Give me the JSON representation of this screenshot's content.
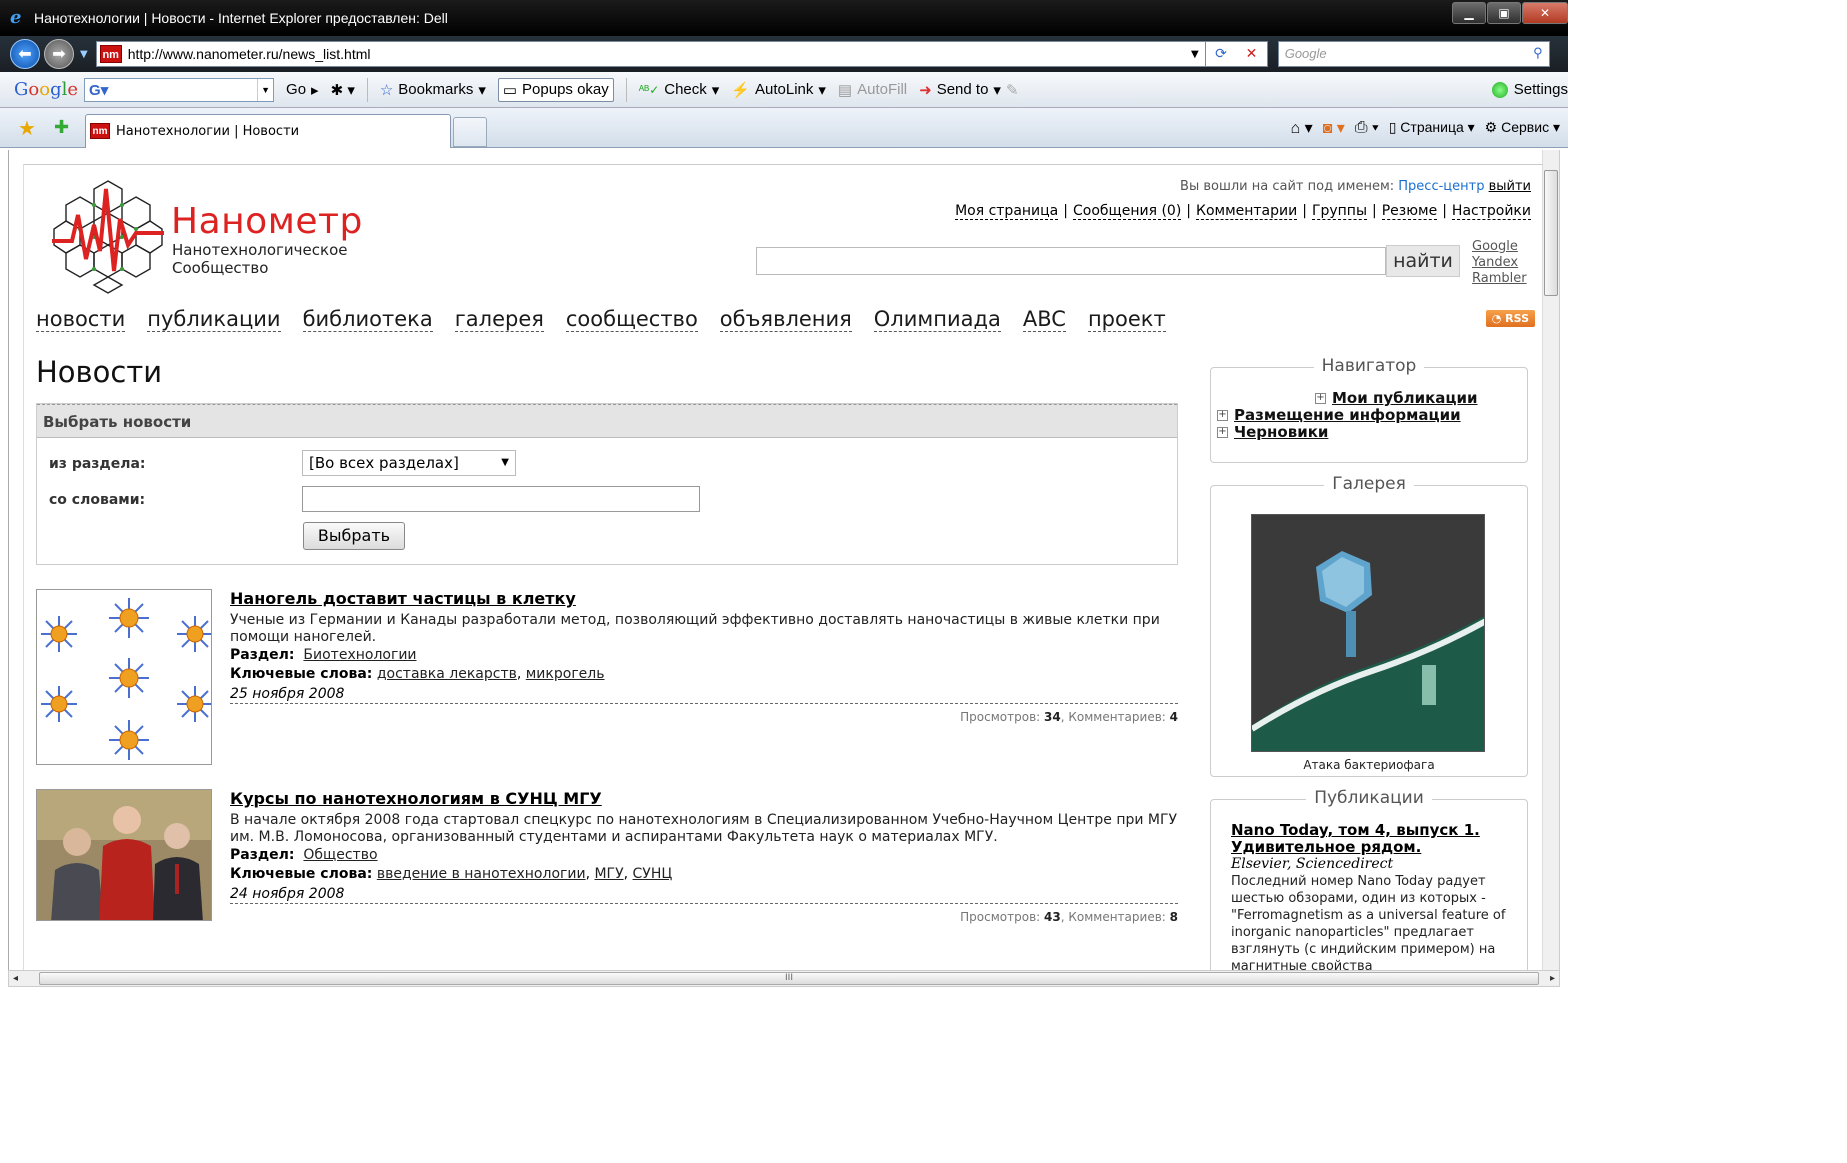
{
  "window": {
    "title": "Нанотехнологии | Новости - Internet Explorer предоставлен: Dell",
    "url": "http://www.nanometer.ru/news_list.html",
    "search_placeholder": "Google"
  },
  "google_toolbar": {
    "logo": "Google",
    "go_label": "Go",
    "bookmarks_label": "Bookmarks",
    "popups_label": "Popups okay",
    "check_label": "Check",
    "autolink_label": "AutoLink",
    "autofill_label": "AutoFill",
    "sendto_label": "Send to",
    "settings_label": "Settings"
  },
  "tabs": {
    "active_label": "Нанотехнологии | Новости"
  },
  "command_bar": {
    "page_label": "Страница",
    "tools_label": "Сервис"
  },
  "site": {
    "brand": "Нанометр",
    "tagline_line1": "Нанотехнологическое",
    "tagline_line2": "Сообщество",
    "logged_in_prefix": "Вы вошли на сайт под именем:",
    "username": "Пресс-центр",
    "logout": "выйти",
    "user_menu": [
      "Моя страница",
      "Сообщения (0)",
      "Комментарии",
      "Группы",
      "Резюме",
      "Настройки"
    ],
    "search_button": "найти",
    "search_engines": [
      "Google",
      "Yandex",
      "Rambler"
    ],
    "nav": [
      "новости",
      "публикации",
      "библиотека",
      "галерея",
      "сообщество",
      "объявления",
      "Олимпиада",
      "ABC",
      "проект"
    ],
    "rss": "RSS"
  },
  "main": {
    "page_title": "Новости",
    "filter": {
      "heading": "Выбрать новости",
      "section_label": "из раздела:",
      "section_value": "[Во всех разделах]",
      "words_label": "со словами:",
      "words_value": "",
      "submit": "Выбрать"
    },
    "news": [
      {
        "title": "Наногель доставит частицы в клетку",
        "lead": "Ученые из Германии и Канады разработали метод, позволяющий эффективно доставлять наночастицы в живые клетки при помощи наногелей.",
        "section_label": "Раздел:",
        "section": "Биотехнологии",
        "keywords_label": "Ключевые слова:",
        "keywords": [
          "доставка лекарств",
          "микрогель"
        ],
        "date": "25 ноября 2008",
        "views_label": "Просмотров:",
        "views": "34",
        "comments_label": "Комментариев:",
        "comments": "4"
      },
      {
        "title": "Курсы по нанотехнологиям в СУНЦ МГУ",
        "lead": "В начале октября 2008 года стартовал спецкурс по нанотехнологиям в Специализированном Учебно-Научном Центре при МГУ им. М.В. Ломоносова, организованный студентами и аспирантами Факультета наук о материалах МГУ.",
        "section_label": "Раздел:",
        "section": "Общество",
        "keywords_label": "Ключевые слова:",
        "keywords": [
          "введение в нанотехнологии",
          "МГУ",
          "СУНЦ"
        ],
        "date": "24 ноября 2008",
        "views_label": "Просмотров:",
        "views": "43",
        "comments_label": "Комментариев:",
        "comments": "8"
      }
    ]
  },
  "sidebar": {
    "navigator": {
      "title": "Навигатор",
      "items": [
        "Мои публикации",
        "Размещение информации",
        "Черновики"
      ]
    },
    "gallery": {
      "title": "Галерея",
      "caption": "Атака бактериофага"
    },
    "publications": {
      "title": "Публикации",
      "item_title": "Nano Today, том 4, выпуск 1. Удивительное рядом.",
      "item_source": "Elsevier, Sciencedirect",
      "item_text": "Последний номер Nano Today радует шестью обзорами, один из которых - \"Ferromagnetism as a universal feature of inorganic nanoparticles\" предлагает взглянуть (с индийским примером) на магнитные свойства"
    }
  }
}
